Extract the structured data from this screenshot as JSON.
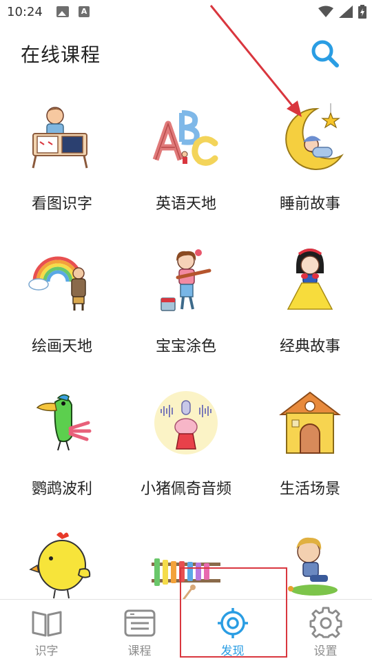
{
  "status_bar": {
    "time": "10:24",
    "icons": [
      "image-notification-icon",
      "a-notification-icon",
      "wifi-icon",
      "signal-icon",
      "battery-icon"
    ]
  },
  "header": {
    "title": "在线课程",
    "search_icon": "search-icon"
  },
  "grid": {
    "items": [
      {
        "label": "看图识字",
        "icon": "boy-reading-book"
      },
      {
        "label": "英语天地",
        "icon": "abc-letters"
      },
      {
        "label": "睡前故事",
        "icon": "baby-sleeping-on-moon"
      },
      {
        "label": "绘画天地",
        "icon": "rainbow-painter"
      },
      {
        "label": "宝宝涂色",
        "icon": "girl-with-paintbrush"
      },
      {
        "label": "经典故事",
        "icon": "snow-white"
      },
      {
        "label": "鹦鹉波利",
        "icon": "parrot"
      },
      {
        "label": "小猪佩奇音频",
        "icon": "peppa-pig-audio"
      },
      {
        "label": "生活场景",
        "icon": "yellow-house"
      },
      {
        "label": "",
        "icon": "yellow-chick"
      },
      {
        "label": "",
        "icon": "xylophone"
      },
      {
        "label": "",
        "icon": "boy-sitting-on-grass"
      }
    ]
  },
  "bottom_nav": {
    "items": [
      {
        "label": "识字",
        "icon": "open-book-icon",
        "active": false
      },
      {
        "label": "课程",
        "icon": "list-card-icon",
        "active": false
      },
      {
        "label": "发现",
        "icon": "target-icon",
        "active": true
      },
      {
        "label": "设置",
        "icon": "gear-icon",
        "active": false
      }
    ]
  },
  "colors": {
    "accent": "#2a9de3",
    "inactive": "#8c8c8c",
    "annotation": "#d9363e"
  }
}
